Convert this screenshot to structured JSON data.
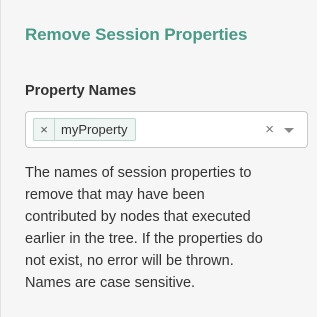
{
  "section": {
    "title": "Remove Session Properties"
  },
  "field": {
    "label": "Property Names",
    "tags": [
      {
        "remove_glyph": "×",
        "label": "myProperty"
      }
    ],
    "clear_glyph": "×",
    "arrow_icon": "chevron-down-icon"
  },
  "help": {
    "lines": [
      "The names of session properties to",
      "remove that may have been",
      "contributed by nodes that executed",
      "earlier in the tree. If the properties do",
      "not exist, no error will be thrown.",
      "Names are case sensitive."
    ]
  },
  "colors": {
    "title": "#4a9a88",
    "tag_border": "#bfd9cf",
    "tag_background": "#eef5f2",
    "panel_background": "#f6f6f6"
  }
}
